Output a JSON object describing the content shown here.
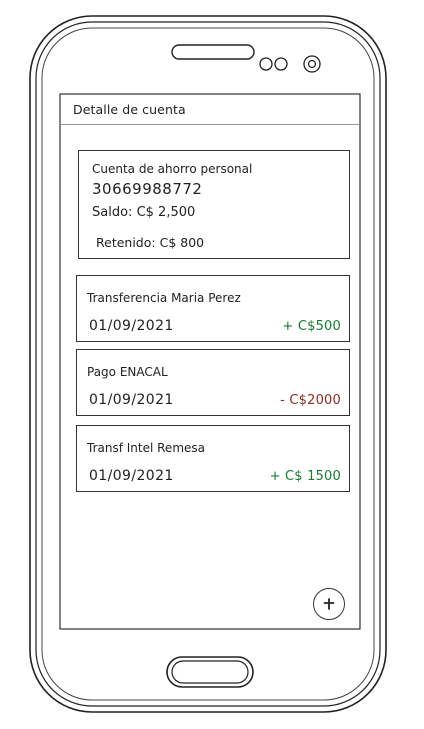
{
  "appbar": {
    "title": "Detalle de cuenta"
  },
  "account": {
    "name": "Cuenta de ahorro personal",
    "number": "30669988772",
    "balance_label": "Saldo:",
    "balance_value": "C$ 2,500",
    "held_label": "Retenido:",
    "held_value": "C$ 800"
  },
  "transactions": [
    {
      "description": "Transferencia Maria Perez",
      "date": "01/09/2021",
      "amount": "+ C$500",
      "kind": "credit"
    },
    {
      "description": "Pago ENACAL",
      "date": "01/09/2021",
      "amount": "- C$2000",
      "kind": "debit"
    },
    {
      "description": "Transf Intel Remesa",
      "date": "01/09/2021",
      "amount": "+ C$ 1500",
      "kind": "credit"
    }
  ],
  "fab": {
    "icon": "plus-icon"
  },
  "colors": {
    "credit": "#1a7a2e",
    "debit": "#8b2c1e",
    "outline": "#333333"
  }
}
